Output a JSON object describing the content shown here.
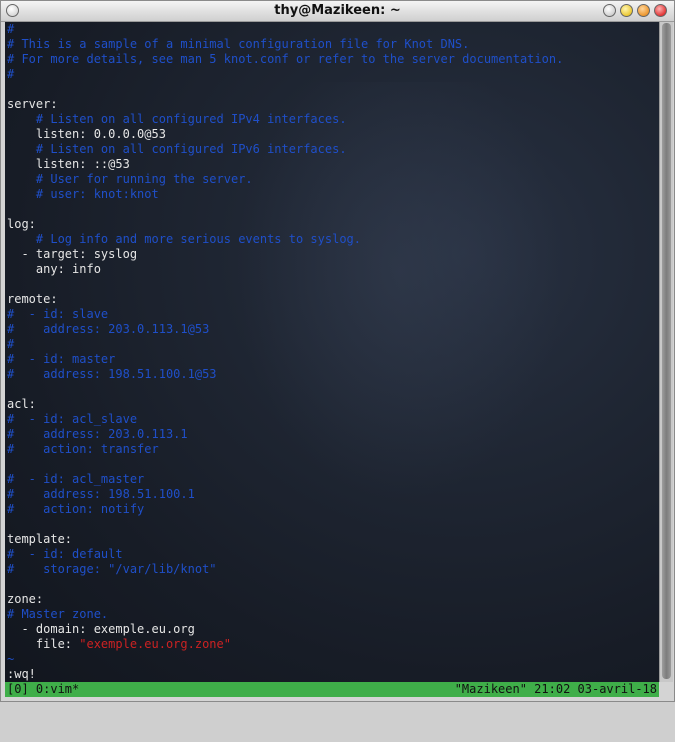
{
  "window": {
    "title": "thy@Mazikeen: ~"
  },
  "editor": {
    "lines": [
      {
        "parts": [
          {
            "text": "#",
            "cls": "c"
          }
        ]
      },
      {
        "parts": [
          {
            "text": "# This is a sample of a minimal configuration file for Knot DNS.",
            "cls": "c"
          }
        ]
      },
      {
        "parts": [
          {
            "text": "# For more details, see man 5 knot.conf or refer to the server documentation.",
            "cls": "c"
          }
        ]
      },
      {
        "parts": [
          {
            "text": "#",
            "cls": "c"
          }
        ]
      },
      {
        "parts": []
      },
      {
        "parts": [
          {
            "text": "server:",
            "cls": "t"
          }
        ]
      },
      {
        "parts": [
          {
            "text": "    # Listen on all configured IPv4 interfaces.",
            "cls": "c"
          }
        ]
      },
      {
        "parts": [
          {
            "text": "    listen: 0.0.0.0@53",
            "cls": "t"
          }
        ]
      },
      {
        "parts": [
          {
            "text": "    # Listen on all configured IPv6 interfaces.",
            "cls": "c"
          }
        ]
      },
      {
        "parts": [
          {
            "text": "    listen: ::@53",
            "cls": "t"
          }
        ]
      },
      {
        "parts": [
          {
            "text": "    # User for running the server.",
            "cls": "c"
          }
        ]
      },
      {
        "parts": [
          {
            "text": "    # user: knot:knot",
            "cls": "c"
          }
        ]
      },
      {
        "parts": []
      },
      {
        "parts": [
          {
            "text": "log:",
            "cls": "t"
          }
        ]
      },
      {
        "parts": [
          {
            "text": "    # Log info and more serious events to syslog.",
            "cls": "c"
          }
        ]
      },
      {
        "parts": [
          {
            "text": "  - target: syslog",
            "cls": "t"
          }
        ]
      },
      {
        "parts": [
          {
            "text": "    any: info",
            "cls": "t"
          }
        ]
      },
      {
        "parts": []
      },
      {
        "parts": [
          {
            "text": "remote:",
            "cls": "t"
          }
        ]
      },
      {
        "parts": [
          {
            "text": "#  - id: slave",
            "cls": "c"
          }
        ]
      },
      {
        "parts": [
          {
            "text": "#    address: 203.0.113.1@53",
            "cls": "c"
          }
        ]
      },
      {
        "parts": [
          {
            "text": "#",
            "cls": "c"
          }
        ]
      },
      {
        "parts": [
          {
            "text": "#  - id: master",
            "cls": "c"
          }
        ]
      },
      {
        "parts": [
          {
            "text": "#    address: 198.51.100.1@53",
            "cls": "c"
          }
        ]
      },
      {
        "parts": []
      },
      {
        "parts": [
          {
            "text": "acl:",
            "cls": "t"
          }
        ]
      },
      {
        "parts": [
          {
            "text": "#  - id: acl_slave",
            "cls": "c"
          }
        ]
      },
      {
        "parts": [
          {
            "text": "#    address: 203.0.113.1",
            "cls": "c"
          }
        ]
      },
      {
        "parts": [
          {
            "text": "#    action: transfer",
            "cls": "c"
          }
        ]
      },
      {
        "parts": []
      },
      {
        "parts": [
          {
            "text": "#  - id: acl_master",
            "cls": "c"
          }
        ]
      },
      {
        "parts": [
          {
            "text": "#    address: 198.51.100.1",
            "cls": "c"
          }
        ]
      },
      {
        "parts": [
          {
            "text": "#    action: notify",
            "cls": "c"
          }
        ]
      },
      {
        "parts": []
      },
      {
        "parts": [
          {
            "text": "template:",
            "cls": "t"
          }
        ]
      },
      {
        "parts": [
          {
            "text": "#  - id: default",
            "cls": "c"
          }
        ]
      },
      {
        "parts": [
          {
            "text": "#    storage: \"/var/lib/knot\"",
            "cls": "c"
          }
        ]
      },
      {
        "parts": []
      },
      {
        "parts": [
          {
            "text": "zone:",
            "cls": "t"
          }
        ]
      },
      {
        "parts": [
          {
            "text": "# Master zone.",
            "cls": "c"
          }
        ]
      },
      {
        "parts": [
          {
            "text": "  - domain: exemple.eu.org",
            "cls": "t"
          }
        ]
      },
      {
        "parts": [
          {
            "text": "    file: ",
            "cls": "t"
          },
          {
            "text": "\"exemple.eu.org.zone\"",
            "cls": "s"
          }
        ]
      },
      {
        "parts": [
          {
            "text": "~",
            "cls": "c"
          }
        ]
      },
      {
        "parts": [
          {
            "text": ":wq!",
            "cls": "t"
          }
        ]
      }
    ]
  },
  "statusbar": {
    "left": "[0] 0:vim*",
    "right": "\"Mazikeen\" 21:02 03-avril-18"
  },
  "colors": {
    "comment": "#1f4fc9",
    "text": "#e6e6e6",
    "string": "#cc2222",
    "status_bg": "#3fae49"
  }
}
